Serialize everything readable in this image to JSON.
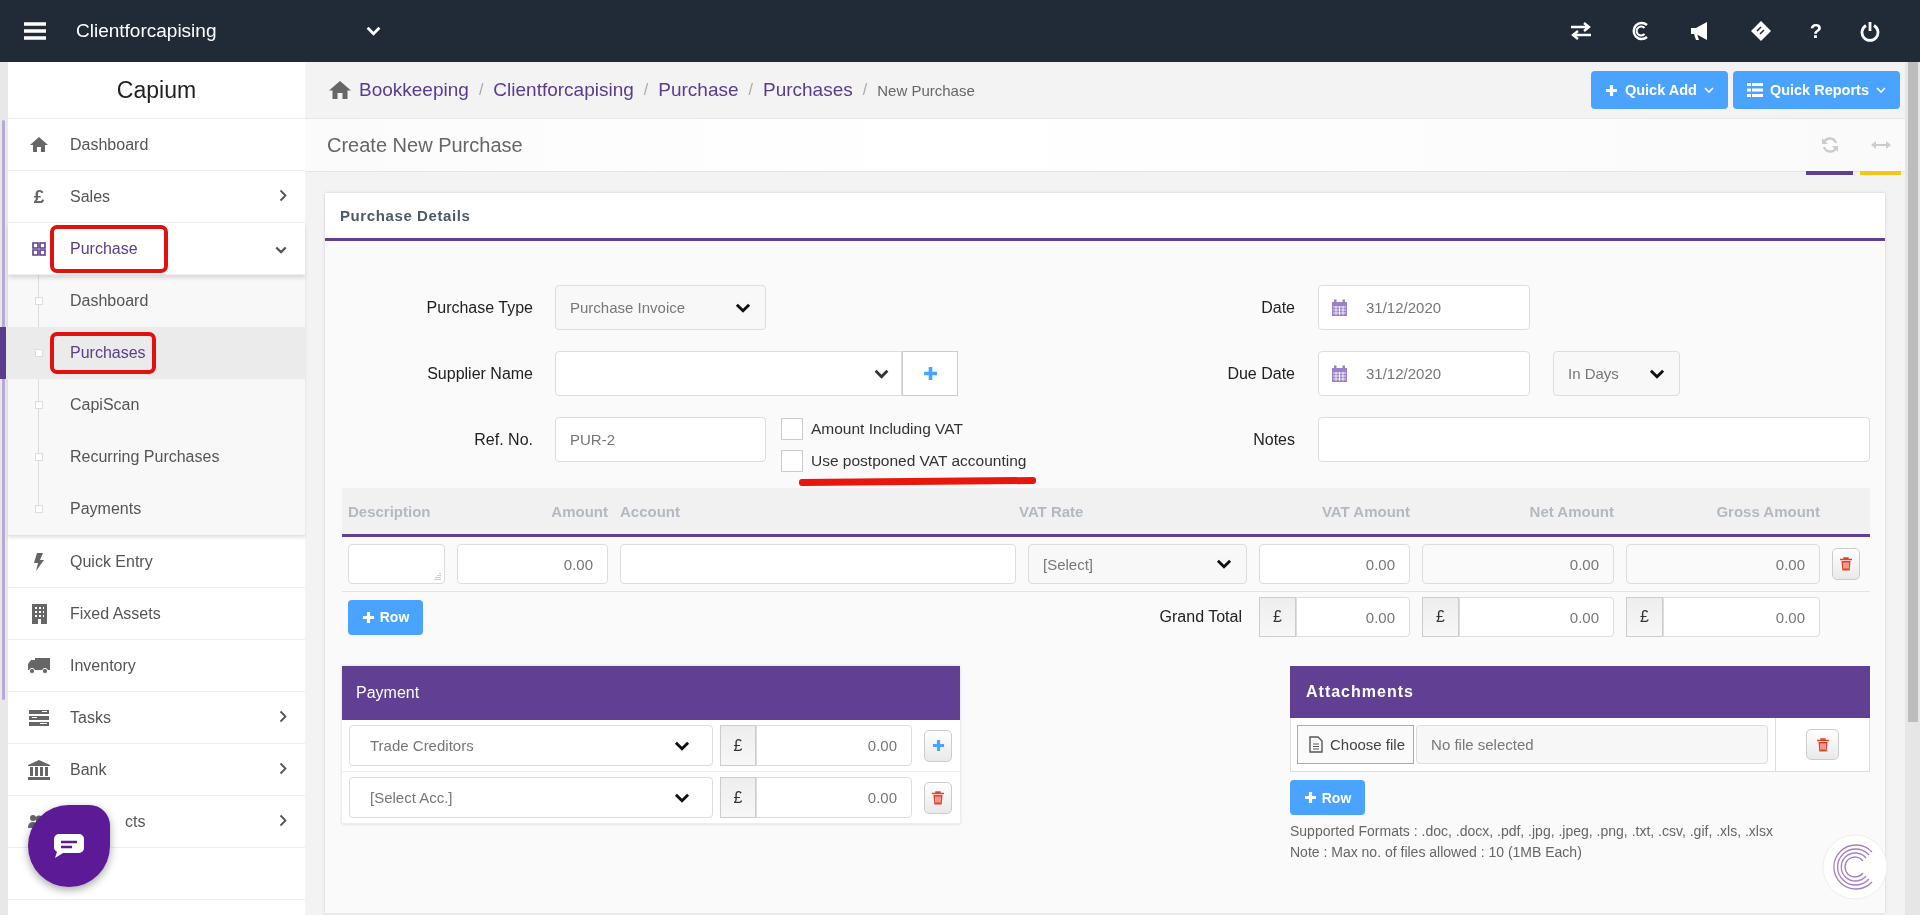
{
  "topbar": {
    "client": "Clientforcapising",
    "help": "?"
  },
  "sidebar": {
    "brand": "Capium",
    "items": [
      {
        "label": "Dashboard",
        "selected": false,
        "highlighted": false
      },
      {
        "label": "Sales",
        "icon_char": "£",
        "expanded": false,
        "selected": false,
        "highlighted": false
      },
      {
        "label": "Purchase",
        "expanded": true,
        "selected": true,
        "highlighted": true,
        "children": [
          {
            "label": "Dashboard",
            "selected": false,
            "highlighted": false
          },
          {
            "label": "Purchases",
            "selected": true,
            "highlighted": true
          },
          {
            "label": "CapiScan",
            "selected": false,
            "highlighted": false
          },
          {
            "label": "Recurring Purchases",
            "selected": false,
            "highlighted": false
          },
          {
            "label": "Payments",
            "selected": false,
            "highlighted": false
          }
        ]
      },
      {
        "label": "Quick Entry",
        "selected": false,
        "highlighted": false
      },
      {
        "label": "Fixed Assets",
        "selected": false,
        "highlighted": false
      },
      {
        "label": "Inventory",
        "selected": false,
        "highlighted": false
      },
      {
        "label": "Tasks",
        "expanded": false,
        "selected": false,
        "highlighted": false
      },
      {
        "label": "Bank",
        "expanded": false,
        "selected": false,
        "highlighted": false
      },
      {
        "label": "cts",
        "expanded": false,
        "selected": false,
        "highlighted": false
      }
    ]
  },
  "breadcrumb": {
    "links": [
      {
        "label": "Bookkeeping",
        "separator": "/"
      },
      {
        "label": "Clientforcapising",
        "separator": "/"
      },
      {
        "label": "Purchase",
        "separator": "/"
      },
      {
        "label": "Purchases",
        "separator": "/"
      }
    ],
    "current": "New Purchase"
  },
  "header_buttons": [
    "Quick Add",
    "Quick Reports"
  ],
  "page_title": "Create New Purchase",
  "purchase_details": {
    "title": "Purchase Details",
    "purchase_type": {
      "label": "Purchase Type",
      "value": "Purchase Invoice"
    },
    "supplier": {
      "label": "Supplier Name"
    },
    "ref_no": {
      "label": "Ref. No.",
      "placeholder": "PUR-2"
    },
    "options": [
      {
        "label": "Amount Including VAT",
        "checked": false,
        "underlined": false
      },
      {
        "label": "Use postponed VAT accounting",
        "checked": false,
        "underlined": true
      }
    ],
    "date": {
      "label": "Date",
      "value": "31/12/2020"
    },
    "due_date": {
      "label": "Due Date",
      "value": "31/12/2020",
      "term": "In Days"
    },
    "notes": {
      "label": "Notes"
    }
  },
  "lines": {
    "columns": [
      "Description",
      "Amount",
      "Account",
      "VAT Rate",
      "VAT Amount",
      "Net Amount",
      "Gross Amount"
    ],
    "rows": [
      {
        "amount": "0.00",
        "vat_rate": "[Select]",
        "vat_amount": "0.00",
        "net_amount": "0.00",
        "gross_amount": "0.00"
      }
    ],
    "add_row": "Row",
    "grand_total": {
      "label": "Grand Total",
      "totals": [
        {
          "currency": "£",
          "value": "0.00"
        },
        {
          "currency": "£",
          "value": "0.00"
        },
        {
          "currency": "£",
          "value": "0.00"
        }
      ]
    }
  },
  "payment": {
    "title": "Payment",
    "rows": [
      {
        "account": "Trade Creditors",
        "currency": "£",
        "amount": "0.00",
        "kind": "add"
      },
      {
        "account": "[Select Acc.]",
        "currency": "£",
        "amount": "0.00",
        "kind": "delete"
      }
    ]
  },
  "attachments": {
    "title": "Attachments",
    "choose": "Choose file",
    "status": "No file selected",
    "add_row": "Row",
    "notes": [
      "Supported Formats : .doc, .docx, .pdf, .jpg, .jpeg, .png, .txt, .csv, .gif, .xls, .xlsx",
      "Note : Max no. of files allowed : 10 (1MB Each)"
    ]
  }
}
